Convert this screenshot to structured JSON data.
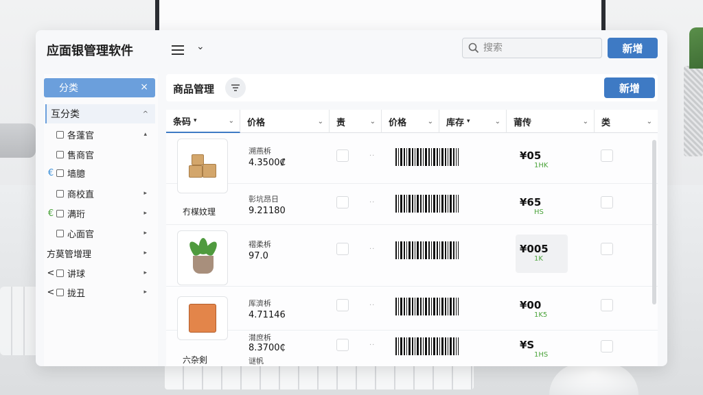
{
  "app": {
    "title": "应面银管理软件"
  },
  "topbar": {
    "search_placeholder": "搜索",
    "new_label": "新增"
  },
  "sidebar": {
    "header": "分类",
    "group": "互分类",
    "items": [
      {
        "prefix": "",
        "checkbox": true,
        "label": "各蓬官",
        "arrow": "▴"
      },
      {
        "prefix": "",
        "checkbox": true,
        "label": "售商官",
        "arrow": ""
      },
      {
        "prefix": "€",
        "checkbox": true,
        "label": "墙臆",
        "arrow": ""
      },
      {
        "prefix": "",
        "checkbox": true,
        "label": "商校直",
        "arrow": "▸"
      },
      {
        "prefix": "€",
        "checkbox": true,
        "label": "满珩",
        "arrow": "▸"
      },
      {
        "prefix": "",
        "checkbox": true,
        "label": "心面官",
        "arrow": "▸"
      },
      {
        "prefix": "",
        "checkbox": false,
        "label": "方莫管增理",
        "arrow": "▸"
      },
      {
        "prefix": "<",
        "checkbox": true,
        "label": "讲球",
        "arrow": "▸"
      },
      {
        "prefix": "<",
        "checkbox": true,
        "label": "拢丑",
        "arrow": "▸"
      }
    ]
  },
  "main": {
    "title": "商品管理",
    "new_label": "新增",
    "columns": [
      "条码",
      "价格",
      "责",
      "价格",
      "库存",
      "莆传",
      "类"
    ],
    "rows": [
      {
        "name": "",
        "label": "溯燕柝",
        "value": "4.3500₡",
        "value2": "",
        "price": "¥05",
        "unit": "1HK",
        "image": "boxes"
      },
      {
        "name": "冇楳妏理",
        "label": "彰坑昂日",
        "value": "9.21180",
        "value2": "",
        "price": "¥65",
        "unit": "HS",
        "image": ""
      },
      {
        "name": "",
        "label": "褶柔柝",
        "value": "97.0",
        "value2": "",
        "price": "¥005",
        "unit": "1K",
        "image": "plant"
      },
      {
        "name": "",
        "label": "厍濟柝",
        "value": "4.71146",
        "value2": "",
        "price": "¥00",
        "unit": "1K5",
        "image": "crate"
      },
      {
        "name": "六杂剣",
        "label": "潸庶柝",
        "value": "8.3700₵",
        "value2": "谜帆",
        "price": "¥S",
        "unit": "1HS",
        "image": ""
      }
    ]
  },
  "colors": {
    "accent": "#3e7ac4",
    "sidebar_header": "#6b9fdc",
    "unit_green": "#4aa33a"
  },
  "icons": [
    "search-icon",
    "menu-icon",
    "chevron-down-icon",
    "close-icon",
    "filter-icon"
  ]
}
